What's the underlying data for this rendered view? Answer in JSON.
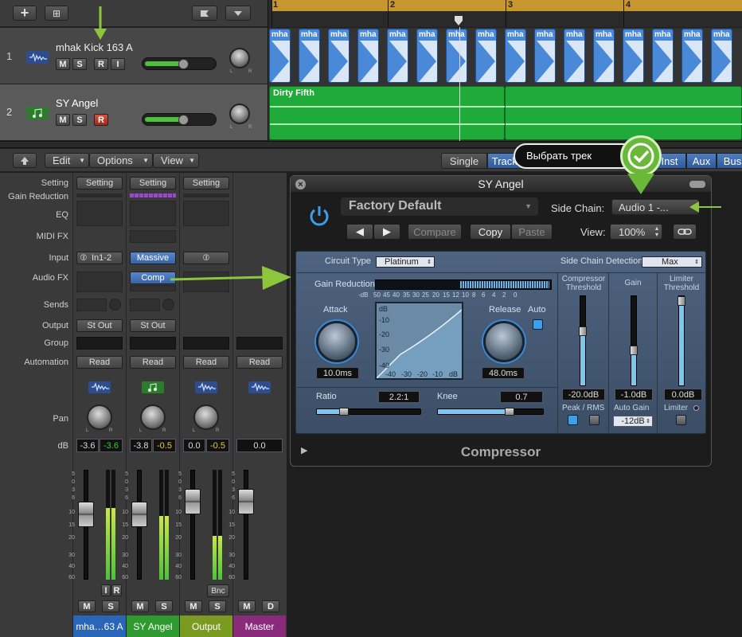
{
  "tracks_header": {
    "add": "+",
    "add_folder": "⊞"
  },
  "ruler": {
    "marks": [
      "1",
      "2",
      "3",
      "4"
    ]
  },
  "tracks": [
    {
      "num": "1",
      "name": "mhak Kick 163 A",
      "m": "M",
      "s": "S",
      "r": "R",
      "i": "I",
      "color": "#4a7ad0",
      "icon": "waveform-icon"
    },
    {
      "num": "2",
      "name": "SY Angel",
      "m": "M",
      "s": "S",
      "r": "R",
      "color": "#3aa03a",
      "icon": "note-icon"
    }
  ],
  "regions": {
    "kick_label": "mha",
    "synth_label": "Dirty Fifth"
  },
  "mixer_toolbar": {
    "edit": "Edit",
    "options": "Options",
    "view": "View",
    "tabs": [
      "Single",
      "Tracks",
      "Inst",
      "Aux",
      "Bus"
    ]
  },
  "mixer_labels": [
    "Setting",
    "Gain Reduction",
    "EQ",
    "MIDI FX",
    "Input",
    "Audio FX",
    "Sends",
    "Output",
    "Group",
    "Automation",
    "Pan",
    "dB"
  ],
  "channels": [
    {
      "setting": "Setting",
      "input": "In1-2",
      "audio_fx": "",
      "output": "St Out",
      "automation": "Read",
      "db1": "-3.6",
      "db2": "-3.6",
      "name": "mha…63 A",
      "name_color": "#2a66b8",
      "m": "M",
      "s": "S",
      "i": "I",
      "r": "R"
    },
    {
      "setting": "Setting",
      "input": "Massive",
      "audio_fx": "Comp",
      "output": "St Out",
      "automation": "Read",
      "db1": "-3.8",
      "db2": "-0.5",
      "name": "SY Angel",
      "name_color": "#2f9a2f",
      "m": "M",
      "s": "S"
    },
    {
      "setting": "Setting",
      "input": "",
      "audio_fx": "",
      "output": "",
      "automation": "Read",
      "db1": "0.0",
      "db2": "-0.5",
      "name": "Output",
      "name_color": "#7a9a22",
      "m": "M",
      "s": "S",
      "bnc": "Bnc"
    },
    {
      "setting": "",
      "input": "",
      "audio_fx": "",
      "output": "",
      "automation": "Read",
      "db1": "0.0",
      "db2": "",
      "name": "Master",
      "name_color": "#8a2a7a",
      "m": "M",
      "d": "D"
    }
  ],
  "fader_scale": [
    "5",
    "0",
    "3",
    "6",
    "10",
    "15",
    "20",
    "30",
    "40",
    "60"
  ],
  "plugin": {
    "title": "SY Angel",
    "preset": "Factory Default",
    "side_chain_label": "Side Chain:",
    "side_chain_value": "Audio 1 -...",
    "compare": "Compare",
    "copy": "Copy",
    "paste": "Paste",
    "view_label": "View:",
    "view_value": "100%",
    "circuit_type_label": "Circuit Type",
    "circuit_type_value": "Platinum",
    "sc_detection_label": "Side Chain Detection",
    "sc_detection_value": "Max",
    "gain_reduction_label": "Gain Reduction",
    "gr_scale": [
      "-dB",
      "50",
      "45",
      "40",
      "35",
      "30",
      "25",
      "20",
      "15",
      "12",
      "10",
      "8",
      "6",
      "4",
      "2",
      "0"
    ],
    "attack_label": "Attack",
    "attack_value": "10.0ms",
    "release_label": "Release",
    "release_value": "48.0ms",
    "auto_label": "Auto",
    "graph_y": [
      "dB",
      "-10",
      "-20",
      "-30",
      "-40"
    ],
    "graph_x": [
      "-40",
      "-30",
      "-20",
      "-10",
      "dB"
    ],
    "ratio_label": "Ratio",
    "ratio_value": "2.2:1",
    "knee_label": "Knee",
    "knee_value": "0.7",
    "comp_thresh_label": "Compressor Threshold",
    "comp_thresh_value": "-20.0dB",
    "gain_label": "Gain",
    "gain_value": "-1.0dB",
    "lim_thresh_label": "Limiter Threshold",
    "lim_thresh_value": "0.0dB",
    "peak_rms_label": "Peak / RMS",
    "auto_gain_label": "Auto Gain",
    "auto_gain_value": "-12dB",
    "limiter_label": "Limiter",
    "footer": "Compressor"
  },
  "callout": {
    "text": "Выбрать трек"
  }
}
